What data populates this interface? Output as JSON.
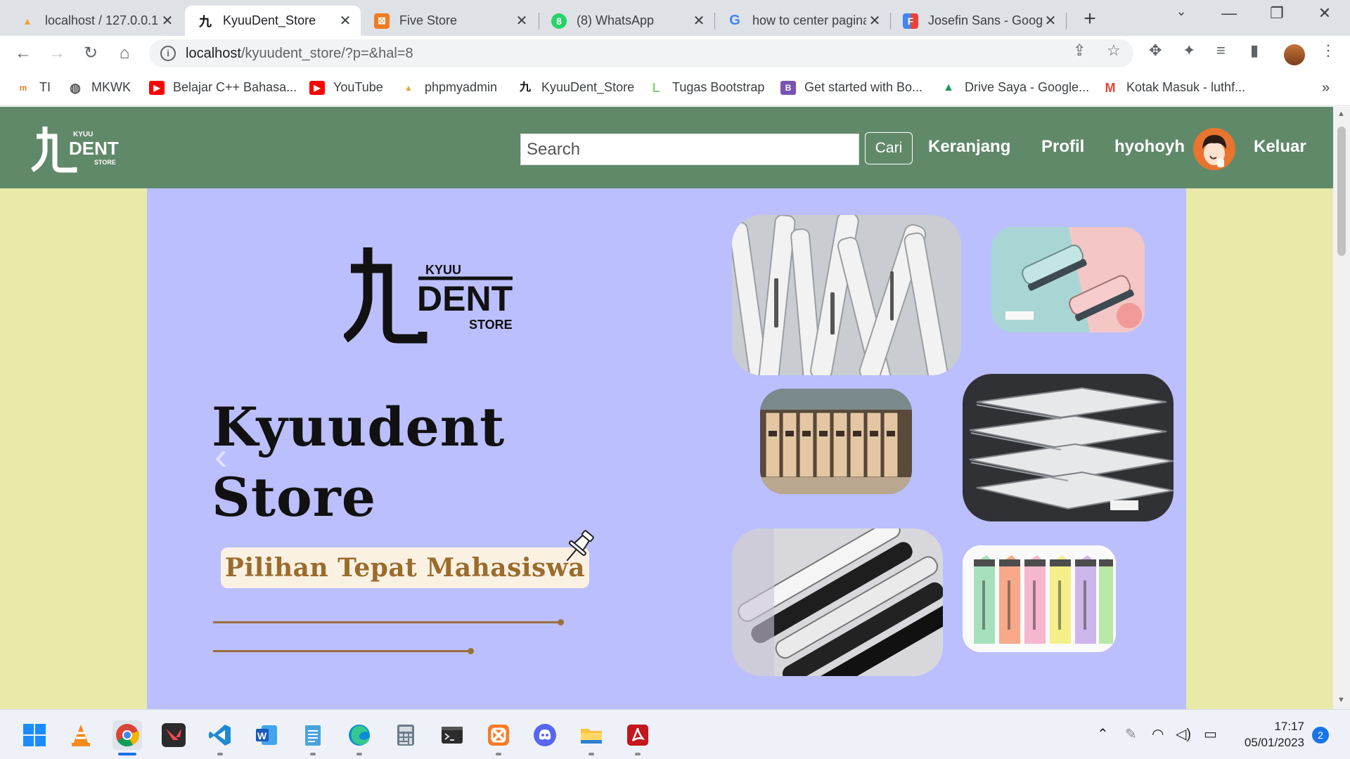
{
  "browser": {
    "tabs": [
      {
        "title": "localhost / 127.0.0.1",
        "favicon": "phpmyadmin-icon",
        "active": false
      },
      {
        "title": "KyuuDent_Store",
        "favicon": "kyuudent-icon",
        "active": true
      },
      {
        "title": "Five Store",
        "favicon": "xampp-icon",
        "active": false
      },
      {
        "title": "(8) WhatsApp",
        "favicon": "whatsapp-icon",
        "active": false
      },
      {
        "title": "how to center pagination",
        "favicon": "google-icon",
        "active": false
      },
      {
        "title": "Josefin Sans - Google Fonts",
        "favicon": "google-fonts-icon",
        "active": false
      }
    ],
    "url_host": "localhost",
    "url_path": "/kyuudent_store/?p=&hal=8",
    "bookmarks": [
      {
        "label": "TI",
        "icon": "ti-icon"
      },
      {
        "label": "MKWK",
        "icon": "globe-icon"
      },
      {
        "label": "Belajar C++ Bahasa...",
        "icon": "youtube-icon"
      },
      {
        "label": "YouTube",
        "icon": "youtube-icon"
      },
      {
        "label": "phpmyadmin",
        "icon": "phpmyadmin-icon"
      },
      {
        "label": "KyuuDent_Store",
        "icon": "kyuudent-icon"
      },
      {
        "label": "Tugas Bootstrap",
        "icon": "letter-l-icon"
      },
      {
        "label": "Get started with Bo...",
        "icon": "bootstrap-icon"
      },
      {
        "label": "Drive Saya - Google...",
        "icon": "google-drive-icon"
      },
      {
        "label": "Kotak Masuk - luthf...",
        "icon": "gmail-icon"
      }
    ],
    "bookmarks_overflow": "»"
  },
  "site": {
    "logo": {
      "line1": "KYUU",
      "line2": "DENT",
      "line3": "STORE",
      "kanji": "九"
    },
    "search_placeholder": "Search",
    "search_button": "Cari",
    "nav": {
      "cart": "Keranjang",
      "profile": "Profil",
      "username": "hyohoyh",
      "logout": "Keluar"
    },
    "colors": {
      "navbar": "#60896a",
      "page_bg": "#e9e9a9",
      "hero_bg": "#bbbffe",
      "accent": "#9b6f3b"
    }
  },
  "hero": {
    "title_line1": "Kyuudent",
    "title_line2": "Store",
    "tagline": "Pilihan Tepat Mahasiswa",
    "prev_arrow": "‹",
    "next_arrow": "›",
    "photos": [
      "white pens in cup",
      "pastel staplers",
      "boxed pencils",
      "spiral notebooks on shelf",
      "black and white pens",
      "pastel highlighters"
    ]
  },
  "taskbar": {
    "apps": [
      "windows-start-icon",
      "vlc-icon",
      "chrome-icon",
      "valorant-icon",
      "vscode-icon",
      "word-icon",
      "notepad-icon",
      "edge-icon",
      "calculator-icon",
      "terminal-icon",
      "xampp-icon",
      "discord-icon",
      "file-explorer-icon",
      "acrobat-icon"
    ],
    "time": "17:17",
    "date": "05/01/2023",
    "notifications": "2"
  }
}
